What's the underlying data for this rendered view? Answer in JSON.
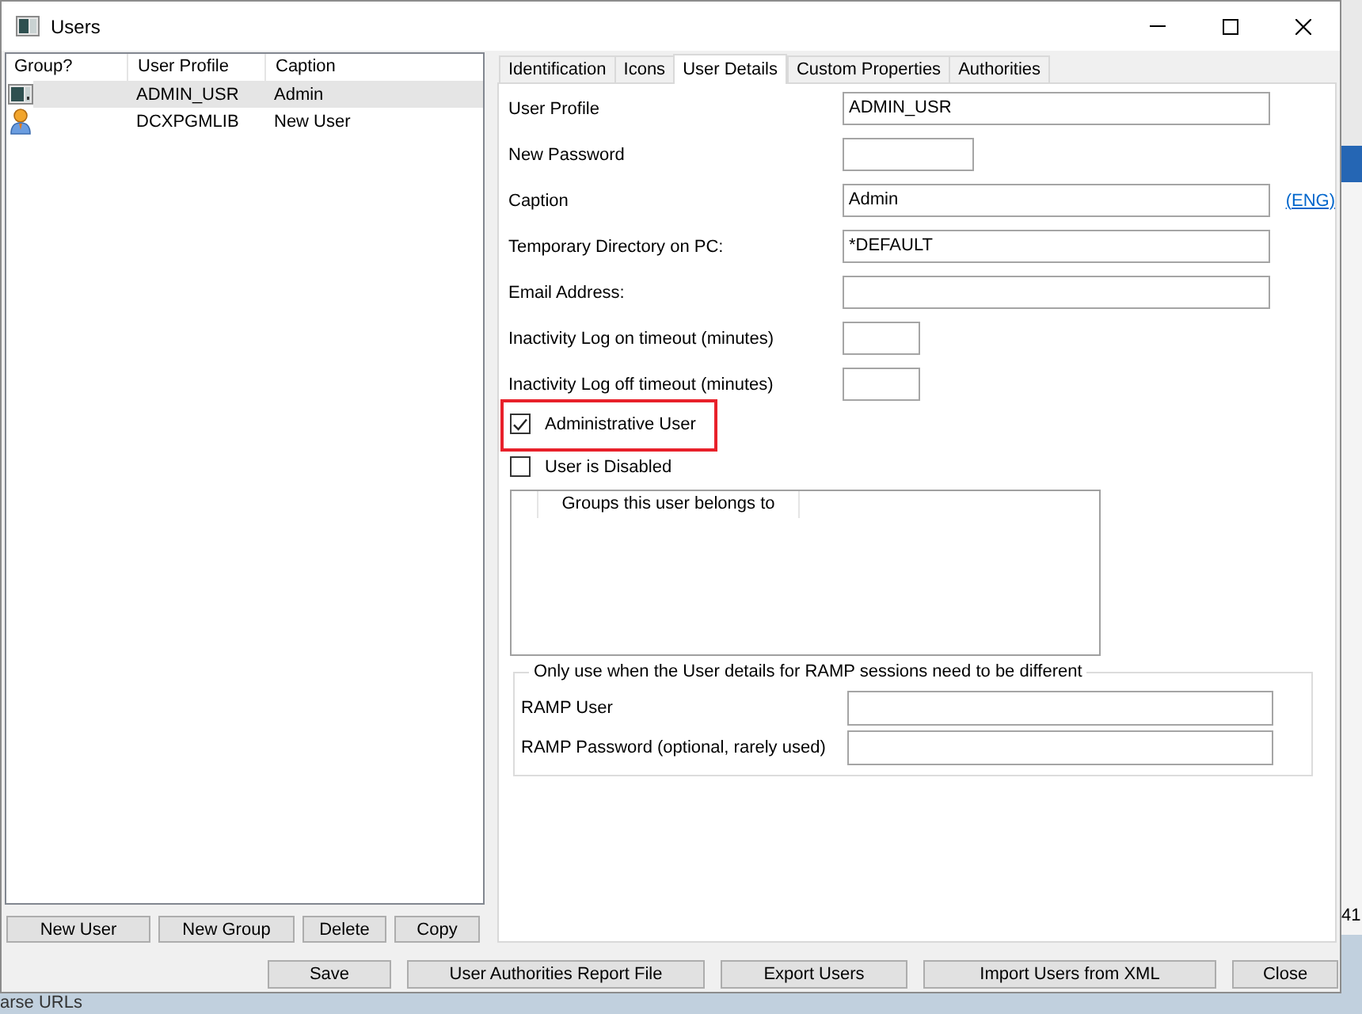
{
  "window": {
    "title": "Users"
  },
  "user_list": {
    "columns": [
      "Group?",
      "User Profile",
      "Caption"
    ],
    "rows": [
      {
        "kind": "window",
        "profile": "ADMIN_USR",
        "caption": "Admin",
        "selected": true
      },
      {
        "kind": "person",
        "profile": "DCXPGMLIB",
        "caption": "New User",
        "selected": false
      }
    ]
  },
  "list_buttons": [
    "New User",
    "New Group",
    "Delete",
    "Copy"
  ],
  "tabs": [
    {
      "label": "Identification",
      "selected": false
    },
    {
      "label": "Icons",
      "selected": false
    },
    {
      "label": "User Details",
      "selected": true
    },
    {
      "label": "Custom Properties",
      "selected": false
    },
    {
      "label": "Authorities",
      "selected": false
    }
  ],
  "fields": [
    {
      "label": "User Profile",
      "kind": "text",
      "value": "ADMIN_USR"
    },
    {
      "label": "New Password",
      "kind": "password"
    },
    {
      "label": "Caption",
      "kind": "text",
      "value": "Admin",
      "link": "(ENG)"
    },
    {
      "label": "Temporary Directory on PC:",
      "kind": "text",
      "value": "*DEFAULT"
    },
    {
      "label": "Email Address:",
      "kind": "text"
    },
    {
      "label": "Inactivity Log on timeout (minutes)",
      "kind": "number"
    },
    {
      "label": "Inactivity Log off timeout (minutes)",
      "kind": "number"
    }
  ],
  "checkboxes": [
    {
      "label": "Administrative User",
      "checked": true,
      "highlighted": true
    },
    {
      "label": "User is Disabled",
      "checked": false,
      "highlighted": false
    }
  ],
  "groups_list": {
    "columns": [
      "Groups this user belongs to"
    ]
  },
  "ramp": {
    "title": "Only use when the User details for RAMP sessions need to be different",
    "fields": [
      {
        "label": "RAMP User"
      },
      {
        "label": "RAMP Password (optional, rarely used)"
      }
    ]
  },
  "buttons": [
    "Save",
    "User Authorities Report File",
    "Export Users",
    "Import Users from XML",
    "Close"
  ],
  "background": {
    "side_text": "41",
    "bottom_text": "arse URLs"
  }
}
